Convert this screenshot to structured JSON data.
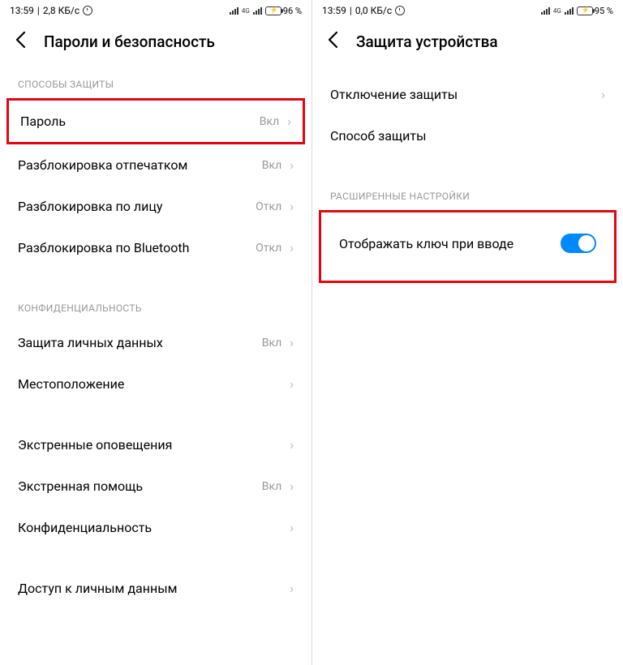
{
  "left": {
    "status": {
      "time": "13:59",
      "speed": "2,8 КБ/с",
      "net": "4G",
      "battery": "96 %"
    },
    "header": {
      "title": "Пароли и безопасность"
    },
    "section1": {
      "header": "СПОСОБЫ ЗАЩИТЫ",
      "items": [
        {
          "label": "Пароль",
          "value": "Вкл"
        },
        {
          "label": "Разблокировка отпечатком",
          "value": "Вкл"
        },
        {
          "label": "Разблокировка по лицу",
          "value": "Откл"
        },
        {
          "label": "Разблокировка по Bluetooth",
          "value": "Откл"
        }
      ]
    },
    "section2": {
      "header": "КОНФИДЕНЦИАЛЬНОСТЬ",
      "items": [
        {
          "label": "Защита личных данных",
          "value": "Вкл"
        },
        {
          "label": "Местоположение",
          "value": ""
        }
      ]
    },
    "section3": {
      "items": [
        {
          "label": "Экстренные оповещения",
          "value": ""
        },
        {
          "label": "Экстренная помощь",
          "value": "Вкл"
        },
        {
          "label": "Конфиденциальность",
          "value": ""
        }
      ]
    },
    "section4": {
      "items": [
        {
          "label": "Доступ к личным данным",
          "value": ""
        }
      ]
    }
  },
  "right": {
    "status": {
      "time": "13:59",
      "speed": "0,0 КБ/с",
      "net": "4G",
      "battery": "95 %"
    },
    "header": {
      "title": "Защита устройства"
    },
    "section1": {
      "items": [
        {
          "label": "Отключение защиты",
          "value": ""
        },
        {
          "label": "Способ защиты",
          "value": ""
        }
      ]
    },
    "section2": {
      "header": "РАСШИРЕННЫЕ НАСТРОЙКИ",
      "items": [
        {
          "label": "Отображать ключ при вводе"
        }
      ]
    }
  }
}
